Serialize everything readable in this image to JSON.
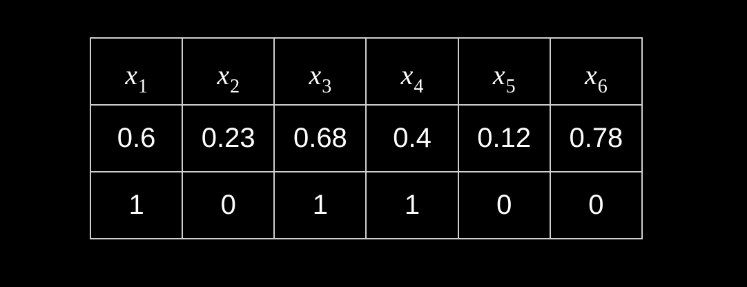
{
  "table": {
    "headers": [
      {
        "var": "x",
        "sub": "1"
      },
      {
        "var": "x",
        "sub": "2"
      },
      {
        "var": "x",
        "sub": "3"
      },
      {
        "var": "x",
        "sub": "4"
      },
      {
        "var": "x",
        "sub": "5"
      },
      {
        "var": "x",
        "sub": "6"
      }
    ],
    "rows": [
      [
        "0.6",
        "0.23",
        "0.68",
        "0.4",
        "0.12",
        "0.78"
      ],
      [
        "1",
        "0",
        "1",
        "1",
        "0",
        "0"
      ]
    ],
    "colors": {
      "background": "#000000",
      "text": "#ffffff",
      "border": "#cfcfcf"
    }
  }
}
